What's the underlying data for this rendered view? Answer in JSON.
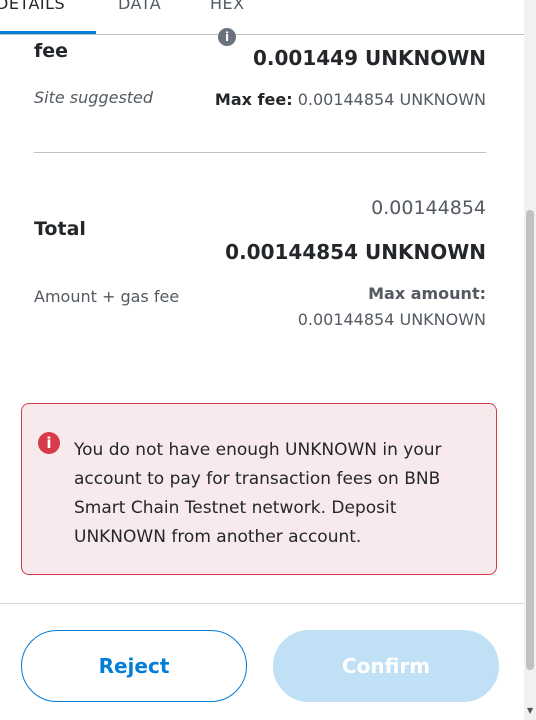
{
  "tabs": [
    {
      "label": "DETAILS",
      "active": true
    },
    {
      "label": "DATA",
      "active": false
    },
    {
      "label": "HEX",
      "active": false
    }
  ],
  "gas": {
    "fee_label": "fee",
    "fee_value": "0.001449 UNKNOWN",
    "site_suggested": "Site suggested",
    "max_fee_label": "Max fee:",
    "max_fee_value": "0.00144854 UNKNOWN"
  },
  "total": {
    "label": "Total",
    "secondary": "0.00144854",
    "primary": "0.00144854 UNKNOWN",
    "amount_gas_label": "Amount + gas fee",
    "max_amount_label": "Max amount:",
    "max_amount_value": "0.00144854 UNKNOWN"
  },
  "alert": {
    "message": "You do not have enough UNKNOWN in your\naccount to pay for transaction fees on BNB\nSmart Chain Testnet network. Deposit\nUNKNOWN from another account.",
    "icon": "info-icon"
  },
  "buttons": {
    "reject": "Reject",
    "confirm": "Confirm"
  },
  "colors": {
    "accent": "#037dd6",
    "danger": "#d73a49",
    "danger_bg": "#f8eaec",
    "confirm_disabled": "#bfe0f5"
  }
}
